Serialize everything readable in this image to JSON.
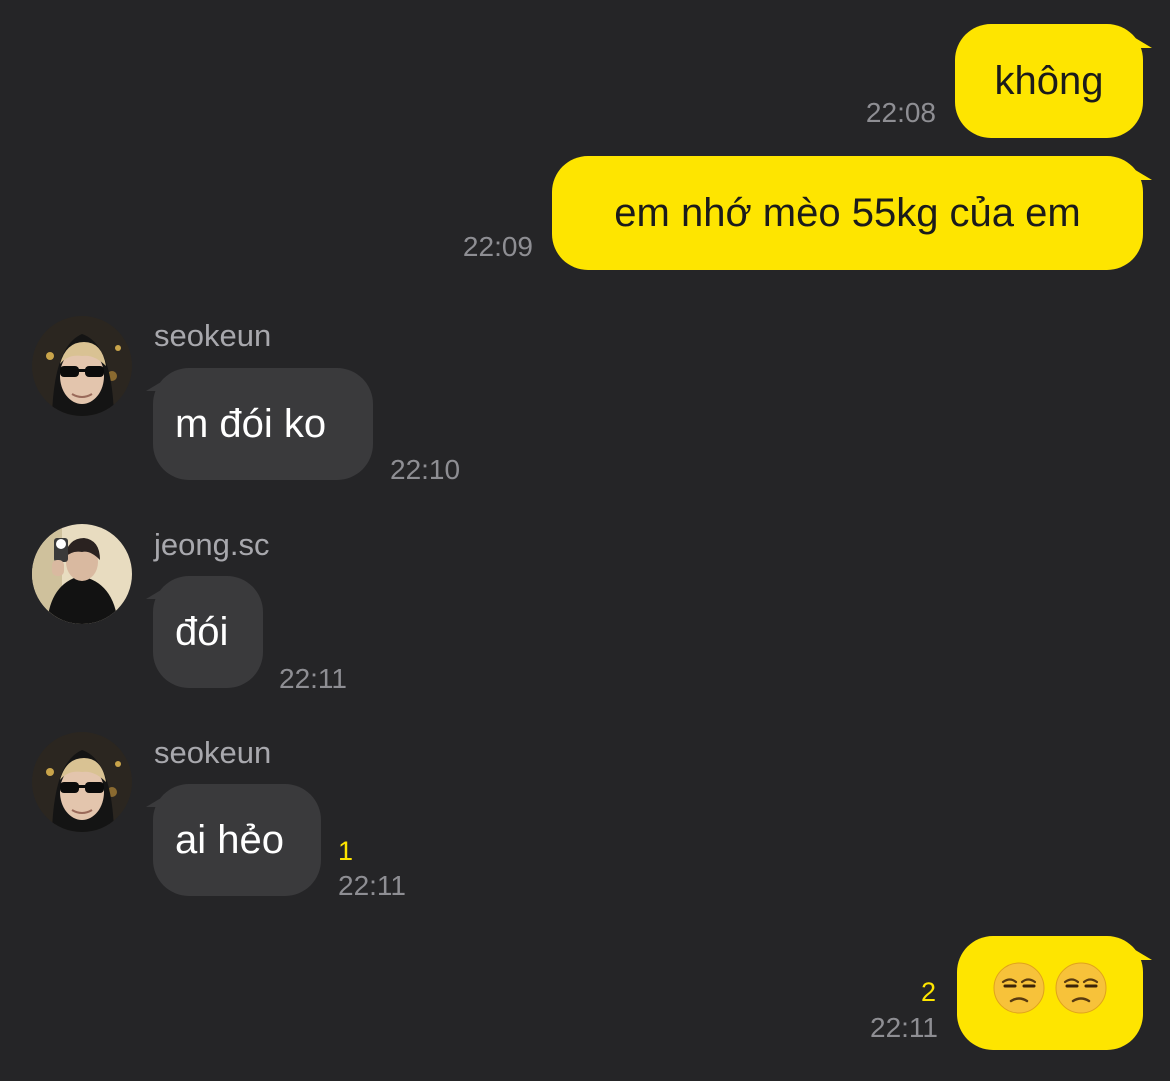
{
  "messages": [
    {
      "direction": "outgoing",
      "text": "không",
      "time": "22:08"
    },
    {
      "direction": "outgoing",
      "text": "em nhớ mèo 55kg của em",
      "time": "22:09"
    },
    {
      "direction": "incoming",
      "sender": "seokeun",
      "text": "m đói ko",
      "time": "22:10"
    },
    {
      "direction": "incoming",
      "sender": "jeong.sc",
      "text": "đói",
      "time": "22:11"
    },
    {
      "direction": "incoming",
      "sender": "seokeun",
      "text": "ai hẻo",
      "time": "22:11",
      "unread": "1"
    },
    {
      "direction": "outgoing",
      "emoji": [
        "unamused-face",
        "unamused-face"
      ],
      "time": "22:11",
      "unread": "2"
    }
  ],
  "colors": {
    "background": "#252527",
    "outgoing_bubble": "#FEE500",
    "incoming_bubble": "#3a3a3c",
    "timestamp": "#8e8e93",
    "unread_count": "#FEE500"
  }
}
